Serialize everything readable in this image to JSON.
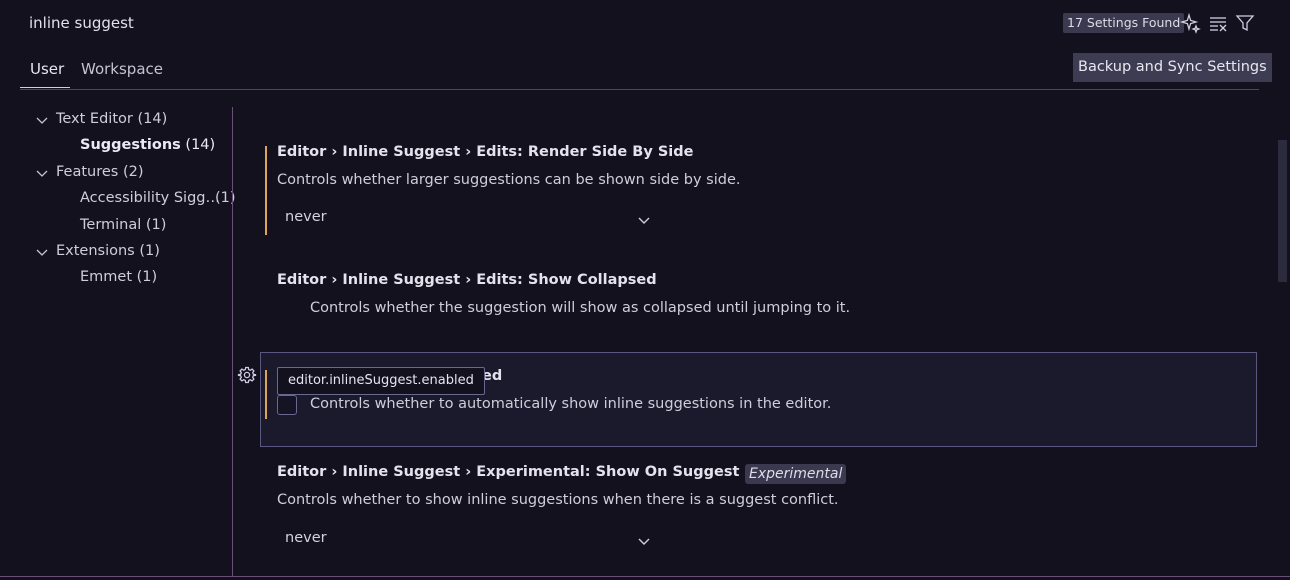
{
  "header": {
    "search_value": "inline suggest",
    "results_count": "17 Settings Found",
    "tabs": [
      {
        "label": "User"
      },
      {
        "label": "Workspace"
      }
    ],
    "backup_label": "Backup and Sync Settings"
  },
  "tree": [
    {
      "label": "Text Editor",
      "count": "(14)"
    },
    {
      "label": "Suggestions",
      "count": "(14)"
    },
    {
      "label": "Features",
      "count": "(2)"
    },
    {
      "label": "Accessibility Sigg…",
      "count": "(1)"
    },
    {
      "label": "Terminal",
      "count": "(1)"
    },
    {
      "label": "Extensions",
      "count": "(1)"
    },
    {
      "label": "Emmet",
      "count": "(1)"
    }
  ],
  "settings": {
    "render_side_by_side": {
      "title": "Editor › Inline Suggest › Edits: Render Side By Side",
      "description": "Controls whether larger suggestions can be shown side by side.",
      "value": "never"
    },
    "show_collapsed": {
      "title": "Editor › Inline Suggest › Edits: Show Collapsed",
      "description": "Controls whether the suggestion will show as collapsed until jumping to it."
    },
    "enabled": {
      "title_tail": "ed",
      "tooltip": "editor.inlineSuggest.enabled",
      "description": "Controls whether to automatically show inline suggestions in the editor.",
      "checked": false
    },
    "suggest_conflict": {
      "title": "Editor › Inline Suggest › Experimental: Show On Suggest Conflict",
      "tag": "Experimental",
      "description": "Controls whether to show inline suggestions when there is a suggest conflict.",
      "value": "never"
    }
  },
  "colors": {
    "background": "#13111e",
    "modified_indicator": "#e0a456",
    "badge_bg": "#3b3950",
    "focus_border": "#5a5880"
  }
}
